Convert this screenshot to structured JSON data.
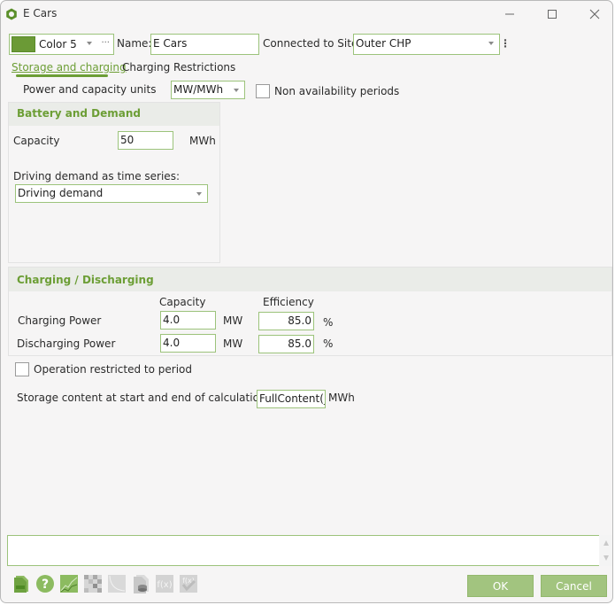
{
  "window": {
    "title": "E Cars",
    "controls": {
      "minimize": "minimize",
      "maximize": "maximize",
      "close": "close"
    }
  },
  "header": {
    "color_swatch": "#6b9a36",
    "color_name": "Color 5",
    "more_label": "···",
    "name_label": "Name:",
    "name_value": "E Cars",
    "site_label": "Connected to Site:",
    "site_value": "Outer CHP",
    "site_menu": "⋮"
  },
  "tabs": [
    {
      "label": "Storage and charging",
      "active": true
    },
    {
      "label": "Charging Restrictions",
      "active": false
    }
  ],
  "units": {
    "label": "Power and capacity units",
    "value": "MW/MWh",
    "non_availability_label": "Non availability periods",
    "non_availability_checked": false
  },
  "battery": {
    "title": "Battery and Demand",
    "capacity_label": "Capacity",
    "capacity_value": "50",
    "capacity_unit": "MWh",
    "demand_label": "Driving demand as time series:",
    "demand_value": "Driving demand"
  },
  "charging": {
    "title": "Charging / Discharging",
    "col_capacity": "Capacity",
    "col_efficiency": "Efficiency",
    "rows": [
      {
        "label": "Charging Power",
        "capacity": "4.0",
        "unit": "MW",
        "efficiency": "85.0",
        "eff_unit": "%"
      },
      {
        "label": "Discharging Power",
        "capacity": "4.0",
        "unit": "MW",
        "efficiency": "85.0",
        "eff_unit": "%"
      }
    ]
  },
  "operation": {
    "label": "Operation restricted to period",
    "checked": false
  },
  "storage_content": {
    "label": "Storage content at start and end of calculation",
    "value": "FullContent(_)",
    "unit": "MWh"
  },
  "message": "",
  "toolbar": [
    {
      "name": "document-icon"
    },
    {
      "name": "help-icon"
    },
    {
      "name": "chart-icon"
    },
    {
      "name": "matrix-icon"
    },
    {
      "name": "curve-icon"
    },
    {
      "name": "database-document-icon"
    },
    {
      "name": "function-icon"
    },
    {
      "name": "function-check-icon"
    }
  ],
  "buttons": {
    "ok": "OK",
    "cancel": "Cancel"
  },
  "colors": {
    "accent": "#6c9e35",
    "border": "#9cc37b",
    "button": "#a2c47f"
  }
}
